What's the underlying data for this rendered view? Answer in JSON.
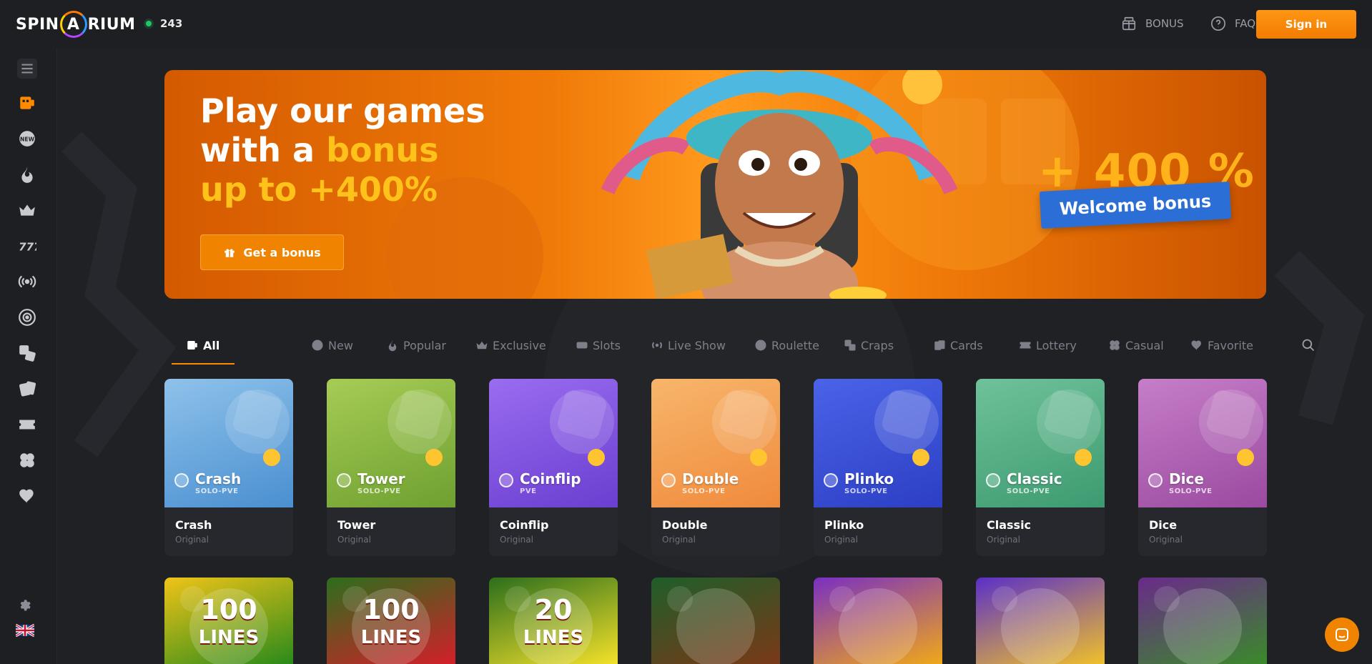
{
  "header": {
    "logo": {
      "left": "SPIN",
      "mark": "A",
      "right": "RIUM"
    },
    "online_count": "243",
    "bonus_label": "BONUS",
    "faq_label": "FAQ",
    "signin_label": "Sign in"
  },
  "sidebar": {
    "items": [
      {
        "icon": "menu-icon"
      },
      {
        "icon": "all-games-icon"
      },
      {
        "icon": "new-badge-icon"
      },
      {
        "icon": "flame-icon"
      },
      {
        "icon": "crown-icon"
      },
      {
        "icon": "slots-icon"
      },
      {
        "icon": "live-icon"
      },
      {
        "icon": "roulette-icon"
      },
      {
        "icon": "dice-icon"
      },
      {
        "icon": "cards-icon"
      },
      {
        "icon": "ticket-icon"
      },
      {
        "icon": "clover-icon"
      },
      {
        "icon": "heart-icon"
      }
    ],
    "bottom": [
      {
        "icon": "gear-icon"
      },
      {
        "icon": "uk-flag-icon"
      }
    ]
  },
  "banner": {
    "line1": "Play our games",
    "line2_white": "with a ",
    "line2_yellow": "bonus",
    "line3": "up to +400%",
    "button_label": "Get a bonus",
    "percent": "+ 400 %",
    "welcome": "Welcome bonus"
  },
  "tabs": [
    {
      "label": "All",
      "icon": "all-games-icon",
      "active": true
    },
    {
      "label": "New",
      "icon": "new-badge-icon"
    },
    {
      "label": "Popular",
      "icon": "flame-icon"
    },
    {
      "label": "Exclusive",
      "icon": "crown-icon"
    },
    {
      "label": "Slots",
      "icon": "slots-icon"
    },
    {
      "label": "Live Show",
      "icon": "live-icon"
    },
    {
      "label": "Roulette",
      "icon": "roulette-icon"
    },
    {
      "label": "Craps",
      "icon": "dice-icon"
    },
    {
      "label": "Cards",
      "icon": "cards-icon"
    },
    {
      "label": "Lottery",
      "icon": "ticket-icon"
    },
    {
      "label": "Casual",
      "icon": "clover-icon"
    },
    {
      "label": "Favorite",
      "icon": "heart-icon"
    }
  ],
  "games": [
    {
      "title": "Crash",
      "mode": "SOLO-PVE",
      "name": "Crash",
      "tag": "Original",
      "color1": "#4a8fd0",
      "color2": "#8ec2ea"
    },
    {
      "title": "Tower",
      "mode": "SOLO-PVE",
      "name": "Tower",
      "tag": "Original",
      "color1": "#6ea030",
      "color2": "#a6cc55"
    },
    {
      "title": "Coinflip",
      "mode": "PVE",
      "name": "Coinflip",
      "tag": "Original",
      "color1": "#6a3fd0",
      "color2": "#9a6cf0"
    },
    {
      "title": "Double",
      "mode": "SOLO-PVE",
      "name": "Double",
      "tag": "Original",
      "color1": "#f08a3c",
      "color2": "#f7b66b"
    },
    {
      "title": "Plinko",
      "mode": "SOLO-PVE",
      "name": "Plinko",
      "tag": "Original",
      "color1": "#2c3fc4",
      "color2": "#4a63e8"
    },
    {
      "title": "Classic",
      "mode": "SOLO-PVE",
      "name": "Classic",
      "tag": "Original",
      "color1": "#3d9a70",
      "color2": "#6fc29a"
    },
    {
      "title": "Dice",
      "mode": "SOLO-PVE",
      "name": "Dice",
      "tag": "Original",
      "color1": "#9a4aa0",
      "color2": "#c67ec8"
    }
  ],
  "slots": [
    {
      "label1": "100",
      "label2": "LINES",
      "color1": "#f0c418",
      "color2": "#2a8a1a"
    },
    {
      "label1": "100",
      "label2": "LINES",
      "color1": "#2c6e1c",
      "color2": "#d31f2a"
    },
    {
      "label1": "20",
      "label2": "LINES",
      "color1": "#2c6e1c",
      "color2": "#f3e12a"
    },
    {
      "label1": "",
      "label2": "",
      "color1": "#1f5e2a",
      "color2": "#7a3818"
    },
    {
      "label1": "",
      "label2": "",
      "color1": "#7a2fc2",
      "color2": "#f0a818"
    },
    {
      "label1": "",
      "label2": "",
      "color1": "#5a2fc8",
      "color2": "#f0c02a"
    },
    {
      "label1": "",
      "label2": "",
      "color1": "#6a2a8a",
      "color2": "#3a8a2a"
    }
  ]
}
